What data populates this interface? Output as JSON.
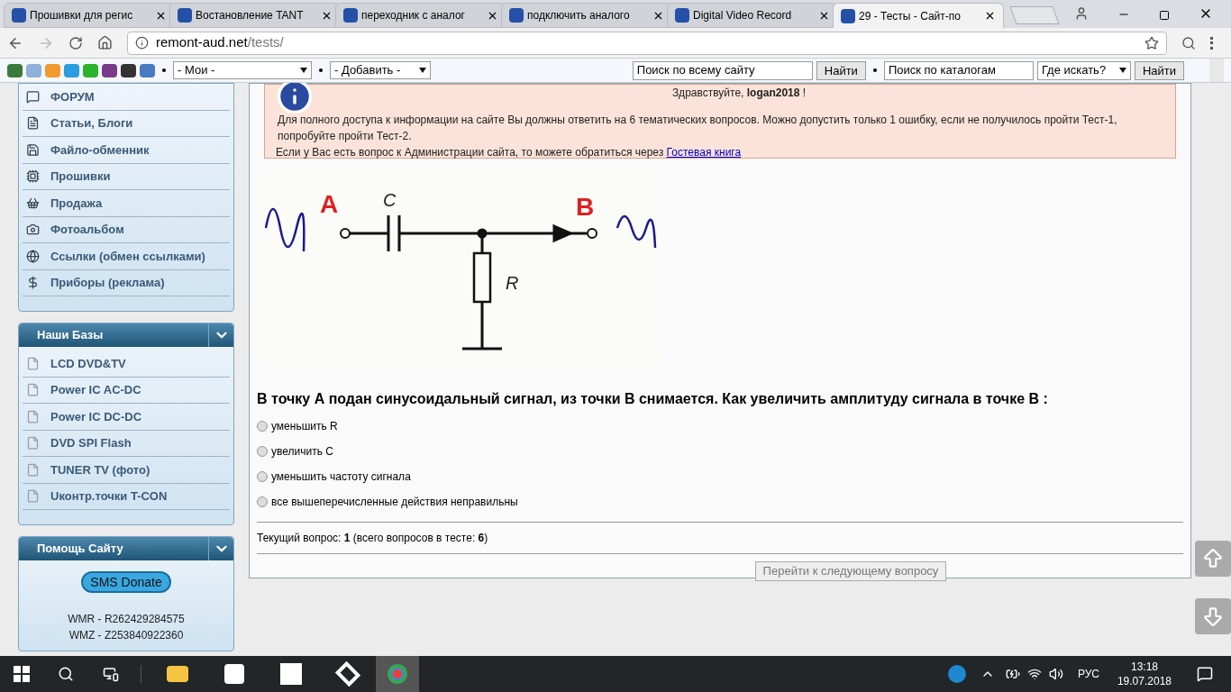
{
  "browser": {
    "tabs": [
      {
        "title": "Прошивки для регис",
        "selected": false
      },
      {
        "title": "Востановление TANT",
        "selected": false
      },
      {
        "title": "переходник с аналог",
        "selected": false
      },
      {
        "title": "подключить аналого",
        "selected": false
      },
      {
        "title": "Digital Video Record",
        "selected": false
      },
      {
        "title": "29 - Тесты - Сайт-по",
        "selected": true
      }
    ],
    "address": {
      "host": "remont-aud.net",
      "path": "/tests/"
    }
  },
  "site_toolbar": {
    "my_select": "- Мои -",
    "add_select": "- Добавить -",
    "site_search": "Поиск по всему сайту",
    "site_search_button": "Найти",
    "catalog_search": "Поиск по каталогам",
    "where_select": "Где искать?",
    "catalog_search_button": "Найти"
  },
  "sidebar": {
    "menu": [
      {
        "label": "ФОРУМ"
      },
      {
        "label": "Статьи, Блоги"
      },
      {
        "label": "Файло-обменник"
      },
      {
        "label": "Прошивки"
      },
      {
        "label": "Продажа"
      },
      {
        "label": "Фотоальбом"
      },
      {
        "label": "Ссылки (обмен ссылками)"
      },
      {
        "label": "Приборы (реклама)"
      }
    ],
    "bases": {
      "title": "Наши Базы",
      "items": [
        "LCD DVD&TV",
        "Power IC AC-DC",
        "Power IC DC-DC",
        "DVD SPI Flash",
        "TUNER TV (фото)",
        "Uконтр.точки T-CON"
      ]
    },
    "help": {
      "title": "Помощь Сайту",
      "donate_button": "SMS Donate",
      "lines": [
        "WMR - R262429284575",
        "WMZ - Z253840922360"
      ]
    }
  },
  "notice": {
    "greeting": "Здравствуйте, **logan2018** !",
    "text": "Для полного доступа к информации на сайте Вы должны ответить на 6 тематических вопросов. Можно допустить только 1 ошибку, если не получилось пройти Тест-1, попробуйте пройти Тест-2.",
    "contact": "Если у Вас есть вопрос к Администрации сайта, то можете обратиться через",
    "link": "Гостевая книга"
  },
  "circuit": {
    "labels": {
      "input": "A",
      "capacitor": "C",
      "output": "B",
      "resistor": "R"
    }
  },
  "question": {
    "text": "В точку А подан синусоидальный сигнал, из точки В снимается. Как увеличить амплитуду сигнала в точке В :",
    "options": [
      {
        "label": "уменьшить R",
        "selected": false
      },
      {
        "label": "увеличить С",
        "selected": false
      },
      {
        "label": "уменьшить частоту сигнала",
        "selected": false
      },
      {
        "label": "все вышеперечисленные действия неправильны",
        "selected": false
      }
    ],
    "progress": "Текущий вопрос: **1** (всего вопросов в тесте: **6**)",
    "next_button": {
      "label": "Перейти к следующему вопросу",
      "disabled": true
    }
  },
  "taskbar": {
    "language": "РУС",
    "time": "13:18",
    "date": "19.07.2018"
  }
}
